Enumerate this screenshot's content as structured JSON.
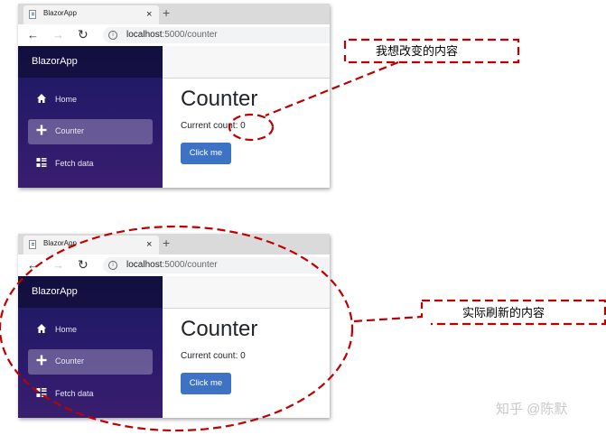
{
  "screenshots": [
    {
      "tab": {
        "title": "BlazorApp",
        "close": "×",
        "new_tab": "+"
      },
      "toolbar": {
        "back": "←",
        "forward": "→",
        "reload": "↻",
        "url_host": "localhost",
        "url_path": ":5000/counter"
      },
      "sidebar": {
        "brand": "BlazorApp",
        "items": [
          {
            "label": "Home",
            "icon": "home-icon",
            "active": false
          },
          {
            "label": "Counter",
            "icon": "plus-icon",
            "active": true
          },
          {
            "label": "Fetch data",
            "icon": "list-icon",
            "active": false
          }
        ]
      },
      "content": {
        "title": "Counter",
        "count_text": "Current count: 0",
        "button_label": "Click me"
      }
    },
    {
      "tab": {
        "title": "BlazorApp",
        "close": "×",
        "new_tab": "+"
      },
      "toolbar": {
        "back": "←",
        "forward": "→",
        "reload": "↻",
        "url_host": "localhost",
        "url_path": ":5000/counter"
      },
      "sidebar": {
        "brand": "BlazorApp",
        "items": [
          {
            "label": "Home",
            "icon": "home-icon",
            "active": false
          },
          {
            "label": "Counter",
            "icon": "plus-icon",
            "active": true
          },
          {
            "label": "Fetch data",
            "icon": "list-icon",
            "active": false
          }
        ]
      },
      "content": {
        "title": "Counter",
        "count_text": "Current count: 0",
        "button_label": "Click me"
      }
    }
  ],
  "annotations": {
    "callout_top": "我想改变的内容",
    "callout_bottom": "实际刷新的内容",
    "line_color": "#c00000"
  },
  "watermark": "知乎 @陈默",
  "colors": {
    "sidebar_top": "#1b1a63",
    "sidebar_bottom": "#3a1e6e",
    "button": "#3e72c4"
  }
}
